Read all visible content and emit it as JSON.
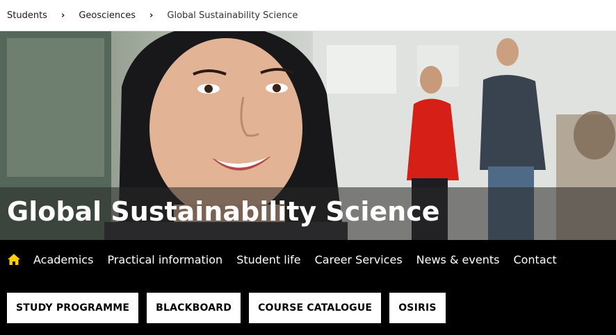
{
  "breadcrumb": {
    "items": [
      "Students",
      "Geosciences"
    ],
    "current": "Global Sustainability Science"
  },
  "hero": {
    "title": "Global Sustainability Science"
  },
  "nav": {
    "home_icon": "home-icon",
    "items": [
      "Academics",
      "Practical information",
      "Student life",
      "Career Services",
      "News & events",
      "Contact"
    ]
  },
  "quick_links": [
    "STUDY PROGRAMME",
    "BLACKBOARD",
    "COURSE CATALOGUE",
    "OSIRIS"
  ],
  "colors": {
    "nav_background": "#000000",
    "accent_yellow": "#ffcd00",
    "button_background": "#ffffff"
  }
}
